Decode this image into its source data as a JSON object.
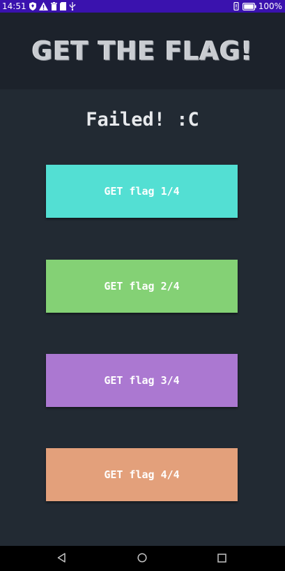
{
  "status_bar": {
    "time": "14:51",
    "battery_percent": "100%",
    "icons_left": [
      "shield-icon",
      "warning-icon",
      "trash-icon",
      "sd-card-icon",
      "usb-icon"
    ],
    "icons_right": [
      "vibrate-icon",
      "battery-icon"
    ]
  },
  "header": {
    "title": "GET THE FLAG!"
  },
  "main": {
    "result_text": "Failed! :C",
    "buttons": [
      {
        "label": "GET flag 1/4",
        "color": "#53dfd3"
      },
      {
        "label": "GET flag 2/4",
        "color": "#84d175"
      },
      {
        "label": "GET flag 3/4",
        "color": "#ab78d1"
      },
      {
        "label": "GET flag 4/4",
        "color": "#e3a07b"
      }
    ]
  },
  "nav_bar": {
    "icons": [
      "back-icon",
      "home-icon",
      "recents-icon"
    ]
  },
  "colors": {
    "status_bar": "#3a12ae",
    "header_bg": "#1c222b",
    "body_bg": "#222a33",
    "nav_bar": "#000000"
  }
}
